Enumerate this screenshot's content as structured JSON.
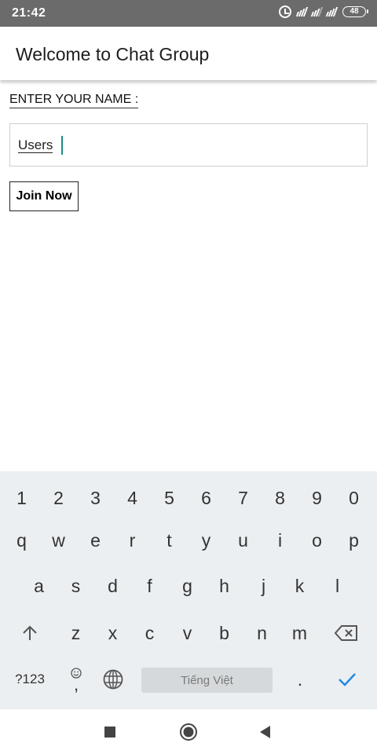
{
  "status_bar": {
    "time": "21:42",
    "battery": "48",
    "icons": [
      "alarm-icon",
      "signal-icon",
      "signal-icon",
      "signal-icon",
      "battery-icon"
    ]
  },
  "app_bar": {
    "title": "Welcome to Chat Group"
  },
  "form": {
    "label": "ENTER YOUR NAME :",
    "name_value": "Users",
    "join_label": "Join Now"
  },
  "keyboard": {
    "number_row": [
      "1",
      "2",
      "3",
      "4",
      "5",
      "6",
      "7",
      "8",
      "9",
      "0"
    ],
    "row1": [
      "q",
      "w",
      "e",
      "r",
      "t",
      "y",
      "u",
      "i",
      "o",
      "p"
    ],
    "row2": [
      "a",
      "s",
      "d",
      "f",
      "g",
      "h",
      "j",
      "k",
      "l"
    ],
    "row3": [
      "z",
      "x",
      "c",
      "v",
      "b",
      "n",
      "m"
    ],
    "symbols_label": "?123",
    "comma": ",",
    "space_label": "Tiếng Việt",
    "period": ".",
    "accent_color": "#1e88e5",
    "icons": [
      "shift-icon",
      "backspace-icon",
      "emoji-icon",
      "globe-icon",
      "check-icon"
    ]
  },
  "nav_bar": {
    "icons": [
      "recents-icon",
      "home-icon",
      "back-icon"
    ]
  },
  "colors": {
    "status_bar": "#6b6b6b",
    "caret": "#1a8f83",
    "keyboard_bg": "#eceff1"
  }
}
